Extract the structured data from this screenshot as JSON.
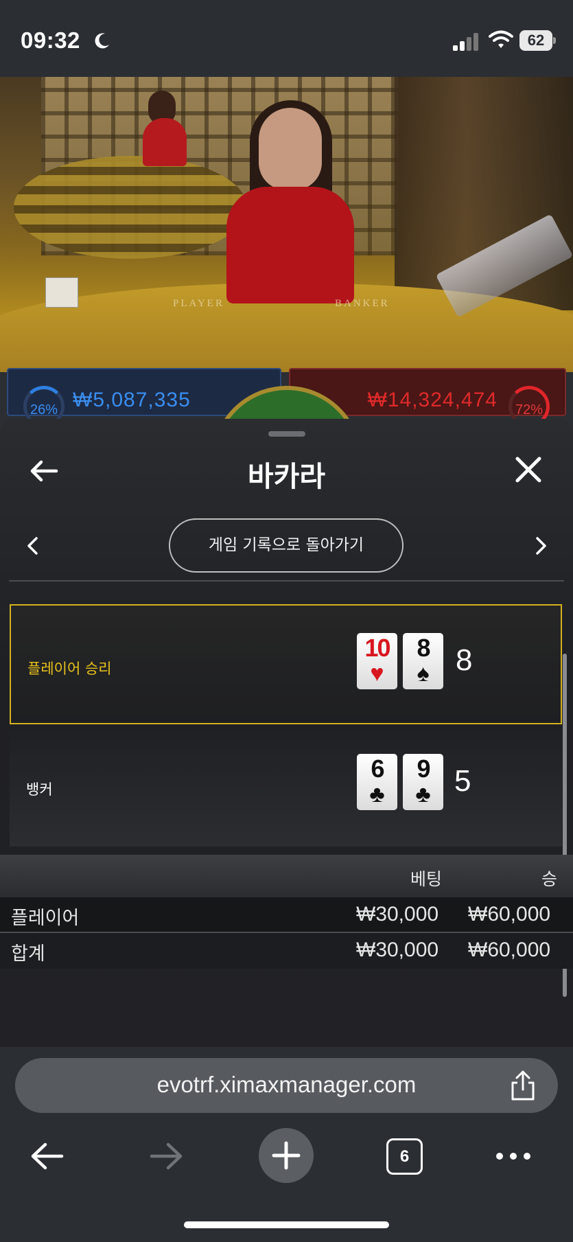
{
  "status_bar": {
    "time": "09:32",
    "battery": "62",
    "icons": [
      "moon-icon",
      "signal-icon",
      "wifi-icon",
      "battery-icon"
    ]
  },
  "video": {
    "table_left_text": "PLAYER",
    "table_right_text": "BANKER",
    "player_percent": "26%",
    "player_amount": "₩5,087,335",
    "banker_percent": "72%",
    "banker_amount": "₩14,324,474",
    "colors": {
      "player": "#3a8ef0",
      "banker": "#e02a2a"
    }
  },
  "sheet": {
    "title": "바카라",
    "history_button": "게임 기록으로 돌아가기",
    "icons": [
      "back-arrow-icon",
      "close-icon",
      "chevron-left-icon",
      "chevron-right-icon"
    ],
    "results": [
      {
        "label": "플레이어 승리",
        "cards": [
          {
            "rank": "10",
            "suit": "♥",
            "color": "red"
          },
          {
            "rank": "8",
            "suit": "♠",
            "color": "black"
          }
        ],
        "score": "8"
      },
      {
        "label": "뱅커",
        "cards": [
          {
            "rank": "6",
            "suit": "♣",
            "color": "black"
          },
          {
            "rank": "9",
            "suit": "♣",
            "color": "black"
          }
        ],
        "score": "5"
      }
    ],
    "bet_table": {
      "headers": [
        "베팅",
        "승"
      ],
      "rows": [
        {
          "label": "플레이어",
          "bet": "₩30,000",
          "win": "₩60,000"
        },
        {
          "label": "합계",
          "bet": "₩30,000",
          "win": "₩60,000"
        }
      ]
    },
    "accent_color": "#d4b21f"
  },
  "browser": {
    "url": "evotrf.ximaxmanager.com",
    "tab_count": "6",
    "icons": [
      "share-icon",
      "back-icon",
      "forward-icon",
      "new-tab-icon",
      "tabs-icon",
      "more-icon"
    ]
  }
}
